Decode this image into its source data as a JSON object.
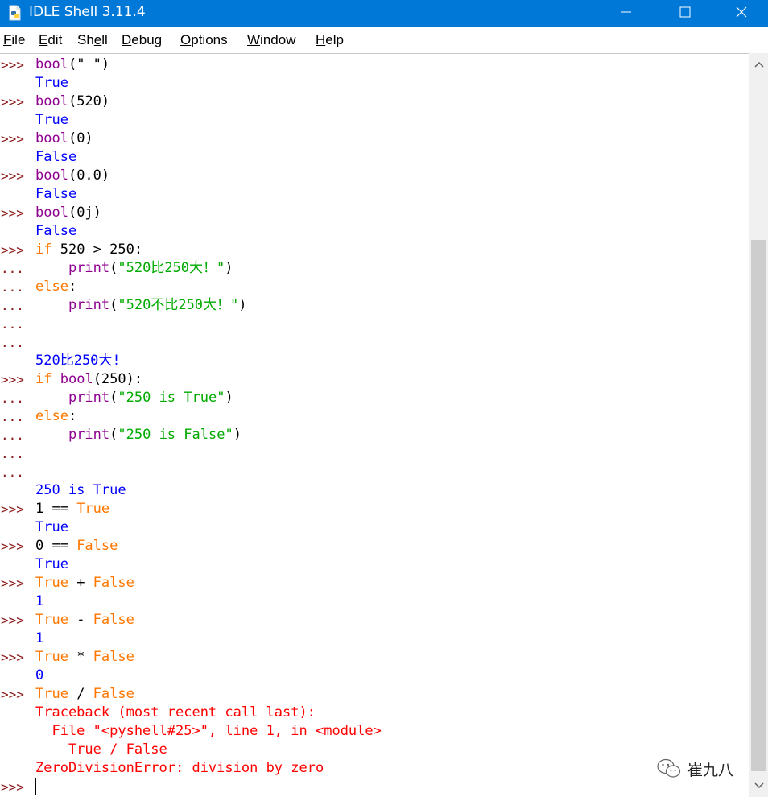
{
  "window": {
    "title": "IDLE Shell 3.11.4",
    "titlebar_color": "#0078d7"
  },
  "menu": [
    {
      "label": "File",
      "mnemonic": "F"
    },
    {
      "label": "Edit",
      "mnemonic": "E"
    },
    {
      "label": "Shell",
      "mnemonic": "e"
    },
    {
      "label": "Debug",
      "mnemonic": "D"
    },
    {
      "label": "Options",
      "mnemonic": "O"
    },
    {
      "label": "Window",
      "mnemonic": "W"
    },
    {
      "label": "Help",
      "mnemonic": "H"
    }
  ],
  "syntax_colors": {
    "keyword": "#ff7700",
    "builtin": "#900090",
    "string": "#00aa00",
    "output": "#0000ff",
    "error": "#ff0000",
    "prompt": "#8b1a1a"
  },
  "shell": {
    "prompts": [
      ">>>",
      "",
      ">>>",
      "",
      ">>>",
      "",
      ">>>",
      "",
      ">>>",
      "",
      ">>>",
      "...",
      "...",
      "...",
      "...",
      "...",
      "",
      ">>>",
      "...",
      "...",
      "...",
      "...",
      "...",
      "",
      ">>>",
      "",
      ">>>",
      "",
      ">>>",
      "",
      ">>>",
      "",
      ">>>",
      "",
      ">>>",
      "",
      "",
      "",
      "",
      ">>>"
    ],
    "lines": [
      [
        {
          "t": "bool",
          "c": "bi"
        },
        {
          "t": "(\" \")",
          "c": "plain"
        }
      ],
      [
        {
          "t": "True",
          "c": "out"
        }
      ],
      [
        {
          "t": "bool",
          "c": "bi"
        },
        {
          "t": "(520)",
          "c": "plain"
        }
      ],
      [
        {
          "t": "True",
          "c": "out"
        }
      ],
      [
        {
          "t": "bool",
          "c": "bi"
        },
        {
          "t": "(0)",
          "c": "plain"
        }
      ],
      [
        {
          "t": "False",
          "c": "out"
        }
      ],
      [
        {
          "t": "bool",
          "c": "bi"
        },
        {
          "t": "(0.0)",
          "c": "plain"
        }
      ],
      [
        {
          "t": "False",
          "c": "out"
        }
      ],
      [
        {
          "t": "bool",
          "c": "bi"
        },
        {
          "t": "(0j)",
          "c": "plain"
        }
      ],
      [
        {
          "t": "False",
          "c": "out"
        }
      ],
      [
        {
          "t": "if",
          "c": "kw"
        },
        {
          "t": " 520 > 250:",
          "c": "plain"
        }
      ],
      [
        {
          "t": "    ",
          "c": "plain"
        },
        {
          "t": "print",
          "c": "bi"
        },
        {
          "t": "(",
          "c": "plain"
        },
        {
          "t": "\"520比250大！\"",
          "c": "str"
        },
        {
          "t": ")",
          "c": "plain"
        }
      ],
      [
        {
          "t": "else",
          "c": "kw"
        },
        {
          "t": ":",
          "c": "plain"
        }
      ],
      [
        {
          "t": "    ",
          "c": "plain"
        },
        {
          "t": "print",
          "c": "bi"
        },
        {
          "t": "(",
          "c": "plain"
        },
        {
          "t": "\"520不比250大！\"",
          "c": "str"
        },
        {
          "t": ")",
          "c": "plain"
        }
      ],
      [],
      [],
      [
        {
          "t": "520比250大!",
          "c": "out"
        }
      ],
      [
        {
          "t": "if",
          "c": "kw"
        },
        {
          "t": " ",
          "c": "plain"
        },
        {
          "t": "bool",
          "c": "bi"
        },
        {
          "t": "(250):",
          "c": "plain"
        }
      ],
      [
        {
          "t": "    ",
          "c": "plain"
        },
        {
          "t": "print",
          "c": "bi"
        },
        {
          "t": "(",
          "c": "plain"
        },
        {
          "t": "\"250 is True\"",
          "c": "str"
        },
        {
          "t": ")",
          "c": "plain"
        }
      ],
      [
        {
          "t": "else",
          "c": "kw"
        },
        {
          "t": ":",
          "c": "plain"
        }
      ],
      [
        {
          "t": "    ",
          "c": "plain"
        },
        {
          "t": "print",
          "c": "bi"
        },
        {
          "t": "(",
          "c": "plain"
        },
        {
          "t": "\"250 is False\"",
          "c": "str"
        },
        {
          "t": ")",
          "c": "plain"
        }
      ],
      [],
      [],
      [
        {
          "t": "250 is True",
          "c": "out"
        }
      ],
      [
        {
          "t": "1 == ",
          "c": "plain"
        },
        {
          "t": "True",
          "c": "kw"
        }
      ],
      [
        {
          "t": "True",
          "c": "out"
        }
      ],
      [
        {
          "t": "0 == ",
          "c": "plain"
        },
        {
          "t": "False",
          "c": "kw"
        }
      ],
      [
        {
          "t": "True",
          "c": "out"
        }
      ],
      [
        {
          "t": "True",
          "c": "kw"
        },
        {
          "t": " + ",
          "c": "plain"
        },
        {
          "t": "False",
          "c": "kw"
        }
      ],
      [
        {
          "t": "1",
          "c": "out"
        }
      ],
      [
        {
          "t": "True",
          "c": "kw"
        },
        {
          "t": " - ",
          "c": "plain"
        },
        {
          "t": "False",
          "c": "kw"
        }
      ],
      [
        {
          "t": "1",
          "c": "out"
        }
      ],
      [
        {
          "t": "True",
          "c": "kw"
        },
        {
          "t": " * ",
          "c": "plain"
        },
        {
          "t": "False",
          "c": "kw"
        }
      ],
      [
        {
          "t": "0",
          "c": "out"
        }
      ],
      [
        {
          "t": "True",
          "c": "kw"
        },
        {
          "t": " / ",
          "c": "plain"
        },
        {
          "t": "False",
          "c": "kw"
        }
      ],
      [
        {
          "t": "Traceback (most recent call last):",
          "c": "err"
        }
      ],
      [
        {
          "t": "  File \"<pyshell#25>\", line 1, in <module>",
          "c": "err"
        }
      ],
      [
        {
          "t": "    True / False",
          "c": "err"
        }
      ],
      [
        {
          "t": "ZeroDivisionError: division by zero",
          "c": "err"
        }
      ],
      []
    ]
  },
  "watermark": {
    "text": "崔九八",
    "icon": "wechat-icon"
  },
  "icons": {
    "app": "idle-app-icon",
    "minimize": "minimize-icon",
    "maximize": "maximize-icon",
    "close": "close-icon",
    "scroll_up": "chevron-up-icon",
    "scroll_down": "chevron-down-icon"
  }
}
